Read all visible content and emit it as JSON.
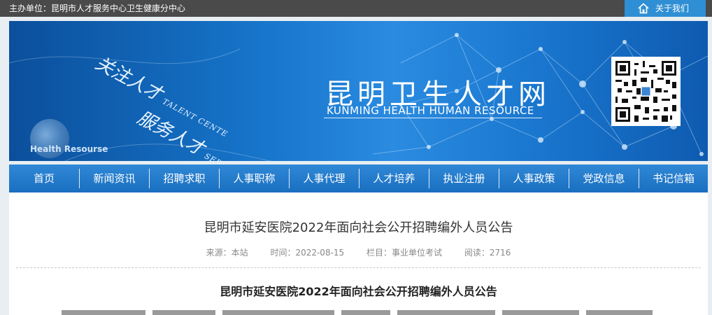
{
  "topbar": {
    "sponsor": "主办单位：昆明市人才服务中心卫生健康分中心",
    "about_label": "关于我们",
    "about_icon": "home-icon"
  },
  "banner": {
    "slogan1_cn": "关注人才",
    "slogan1_en": "TALENT CENTE",
    "slogan2_cn": "服务人才",
    "slogan2_en": "SERVICE RESOURCES",
    "logo_text": "Health Resourse",
    "title_cn": "昆明卫生人才网",
    "title_en": "KUNMING HEALTH HUMAN RESOURCE",
    "qr_icon": "qr-code-icon"
  },
  "nav": {
    "items": [
      "首页",
      "新闻资讯",
      "招聘求职",
      "人事职称",
      "人事代理",
      "人才培养",
      "执业注册",
      "人事政策",
      "党政信息",
      "书记信箱"
    ]
  },
  "article": {
    "title": "昆明市延安医院2022年面向社会公开招聘编外人员公告",
    "source": "来源：本站",
    "time": "时间：2022-08-15",
    "column": "栏目：事业单位考试",
    "views": "阅读：2716",
    "body_title": "昆明市延安医院2022年面向社会公开招聘编外人员公告"
  },
  "colors": {
    "topbar_bg": "#4a4a4a",
    "about_bg": "#2f8fd4",
    "nav_bg": "#1a6fc0",
    "banner_bg": "#1674c9"
  }
}
